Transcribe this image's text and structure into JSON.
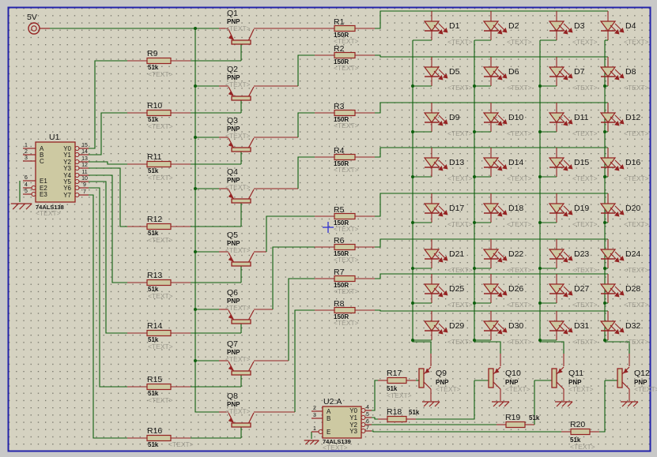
{
  "colors": {
    "canvas": "#d5d2c1",
    "grid_dot": "#6f6e63",
    "margin": "#c8c8c8",
    "sheet_border": "#2222aa",
    "wire": "#0d5f0d",
    "component": "#942222",
    "component_fill": "#cdc9a2",
    "text": "#141414",
    "placeholder_text": "#9a988c",
    "origin_marker": "#3a3ad0"
  },
  "power": {
    "label": "5V"
  },
  "placeholder": "<TEXT>",
  "ics": [
    {
      "ref": "U1",
      "part": "74ALS138",
      "placeholder": "<TEXT>",
      "left_pins": [
        {
          "name": "A",
          "num": "1",
          "bubble": false
        },
        {
          "name": "B",
          "num": "2",
          "bubble": false
        },
        {
          "name": "C",
          "num": "3",
          "bubble": false
        },
        {
          "name": "E1",
          "num": "6",
          "bubble": false
        },
        {
          "name": "E2",
          "num": "4",
          "bubble": true
        },
        {
          "name": "E3",
          "num": "5",
          "bubble": true
        }
      ],
      "right_pins": [
        {
          "name": "Y0",
          "num": "15",
          "bubble": true
        },
        {
          "name": "Y1",
          "num": "14",
          "bubble": true
        },
        {
          "name": "Y2",
          "num": "13",
          "bubble": true
        },
        {
          "name": "Y3",
          "num": "12",
          "bubble": true
        },
        {
          "name": "Y4",
          "num": "11",
          "bubble": true
        },
        {
          "name": "Y5",
          "num": "10",
          "bubble": true
        },
        {
          "name": "Y6",
          "num": "9",
          "bubble": true
        },
        {
          "name": "Y7",
          "num": "7",
          "bubble": true
        }
      ]
    },
    {
      "ref": "U2:A",
      "part": "74ALS139",
      "placeholder": "<TEXT>",
      "left_pins": [
        {
          "name": "A",
          "num": "2",
          "bubble": false
        },
        {
          "name": "B",
          "num": "3",
          "bubble": false
        },
        {
          "name": "E",
          "num": "1",
          "bubble": true
        }
      ],
      "right_pins": [
        {
          "name": "Y0",
          "num": "4",
          "bubble": true
        },
        {
          "name": "Y1",
          "num": "5",
          "bubble": true
        },
        {
          "name": "Y2",
          "num": "6",
          "bubble": true
        },
        {
          "name": "Y3",
          "num": "7",
          "bubble": true
        }
      ]
    }
  ],
  "resistors": {
    "row": [
      {
        "ref": "R1",
        "value": "150R"
      },
      {
        "ref": "R2",
        "value": "150R"
      },
      {
        "ref": "R3",
        "value": "150R"
      },
      {
        "ref": "R4",
        "value": "150R"
      },
      {
        "ref": "R5",
        "value": "150R"
      },
      {
        "ref": "R6",
        "value": "150R"
      },
      {
        "ref": "R7",
        "value": "150R"
      },
      {
        "ref": "R8",
        "value": "150R"
      }
    ],
    "base": [
      {
        "ref": "R9",
        "value": "51k"
      },
      {
        "ref": "R10",
        "value": "51k"
      },
      {
        "ref": "R11",
        "value": "51k"
      },
      {
        "ref": "R12",
        "value": "51k"
      },
      {
        "ref": "R13",
        "value": "51k"
      },
      {
        "ref": "R14",
        "value": "51k"
      },
      {
        "ref": "R15",
        "value": "51k"
      },
      {
        "ref": "R16",
        "value": "51k"
      }
    ],
    "bottom": [
      {
        "ref": "R17",
        "value": "51k"
      },
      {
        "ref": "R18",
        "value": "51k"
      },
      {
        "ref": "R19",
        "value": "51k"
      },
      {
        "ref": "R20",
        "value": "51k"
      }
    ]
  },
  "transistors": {
    "row": [
      {
        "ref": "Q1",
        "type": "PNP"
      },
      {
        "ref": "Q2",
        "type": "PNP"
      },
      {
        "ref": "Q3",
        "type": "PNP"
      },
      {
        "ref": "Q4",
        "type": "PNP"
      },
      {
        "ref": "Q5",
        "type": "PNP"
      },
      {
        "ref": "Q6",
        "type": "PNP"
      },
      {
        "ref": "Q7",
        "type": "PNP"
      },
      {
        "ref": "Q8",
        "type": "PNP"
      }
    ],
    "column": [
      {
        "ref": "Q9",
        "type": "PNP"
      },
      {
        "ref": "Q10",
        "type": "PNP"
      },
      {
        "ref": "Q11",
        "type": "PNP"
      },
      {
        "ref": "Q12",
        "type": "PNP"
      }
    ]
  },
  "leds": [
    "D1",
    "D2",
    "D3",
    "D4",
    "D5",
    "D6",
    "D7",
    "D8",
    "D9",
    "D10",
    "D11",
    "D12",
    "D13",
    "D14",
    "D15",
    "D16",
    "D17",
    "D18",
    "D19",
    "D20",
    "D21",
    "D22",
    "D23",
    "D24",
    "D25",
    "D26",
    "D27",
    "D28",
    "D29",
    "D30",
    "D31",
    "D32"
  ]
}
